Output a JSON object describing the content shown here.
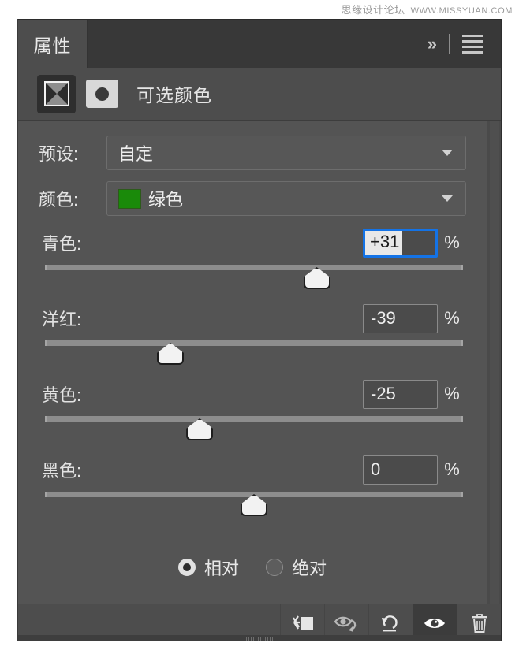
{
  "watermark": {
    "site_cn": "思缘设计论坛",
    "site_url": "WWW.MISSYUAN.COM"
  },
  "panel": {
    "tab_label": "属性",
    "collapse_icon": "double-chevron-right-icon",
    "menu_icon": "hamburger-menu-icon",
    "adjustment_title": "可选颜色",
    "adjustment_icon": "selective-color-adjustment-icon",
    "mask_icon": "layer-mask-thumbnail-icon"
  },
  "preset": {
    "label": "预设:",
    "value": "自定"
  },
  "colors": {
    "label": "颜色:",
    "value": "绿色",
    "swatch_hex": "#1a8a0a"
  },
  "sliders": [
    {
      "name": "cyan",
      "label": "青色:",
      "value": "+31",
      "unit": "%",
      "position_pct": 65,
      "focused": true
    },
    {
      "name": "magenta",
      "label": "洋红:",
      "value": "-39",
      "unit": "%",
      "position_pct": 30,
      "focused": false
    },
    {
      "name": "yellow",
      "label": "黄色:",
      "value": "-25",
      "unit": "%",
      "position_pct": 37,
      "focused": false
    },
    {
      "name": "black",
      "label": "黑色:",
      "value": "0",
      "unit": "%",
      "position_pct": 50,
      "focused": false
    }
  ],
  "method": {
    "relative_label": "相对",
    "absolute_label": "绝对",
    "selected": "相对"
  },
  "footer_buttons": [
    {
      "name": "clip-to-layer-button",
      "icon": "clip-to-layer-icon",
      "active": false
    },
    {
      "name": "view-previous-state-button",
      "icon": "eye-previous-state-icon",
      "active": false
    },
    {
      "name": "reset-button",
      "icon": "reset-arrow-icon",
      "active": false
    },
    {
      "name": "toggle-visibility-button",
      "icon": "eye-visibility-icon",
      "active": true
    },
    {
      "name": "delete-button",
      "icon": "trash-can-icon",
      "active": false
    }
  ],
  "theme": {
    "panel_bg": "#4d4d4d",
    "body_bg": "#545454",
    "tabbar_bg": "#383838",
    "focus_blue": "#1473e6",
    "text": "#e8e8e8"
  }
}
